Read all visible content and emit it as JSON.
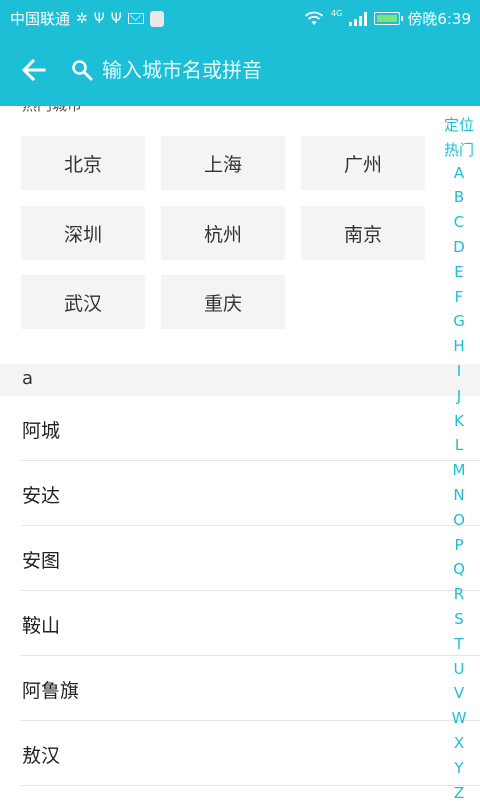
{
  "status_bar": {
    "carrier": "中国联通",
    "left_symbols": [
      "✲",
      "Ψ",
      "Ψ"
    ],
    "network": "4G",
    "time": "傍晚6:39"
  },
  "app_bar": {
    "search_placeholder": "输入城市名或拼音"
  },
  "hot_cities": {
    "title": "热门城市",
    "items": [
      "北京",
      "上海",
      "广州",
      "深圳",
      "杭州",
      "南京",
      "武汉",
      "重庆"
    ]
  },
  "section_letter": "a",
  "cities": [
    "阿城",
    "安达",
    "安图",
    "鞍山",
    "阿鲁旗",
    "敖汉"
  ],
  "index_bar": [
    "定位",
    "热门",
    "A",
    "B",
    "C",
    "D",
    "E",
    "F",
    "G",
    "H",
    "I",
    "J",
    "K",
    "L",
    "M",
    "N",
    "O",
    "P",
    "Q",
    "R",
    "S",
    "T",
    "U",
    "V",
    "W",
    "X",
    "Y",
    "Z"
  ],
  "colors": {
    "primary": "#1cbfd6",
    "chip_bg": "#f4f4f4"
  }
}
